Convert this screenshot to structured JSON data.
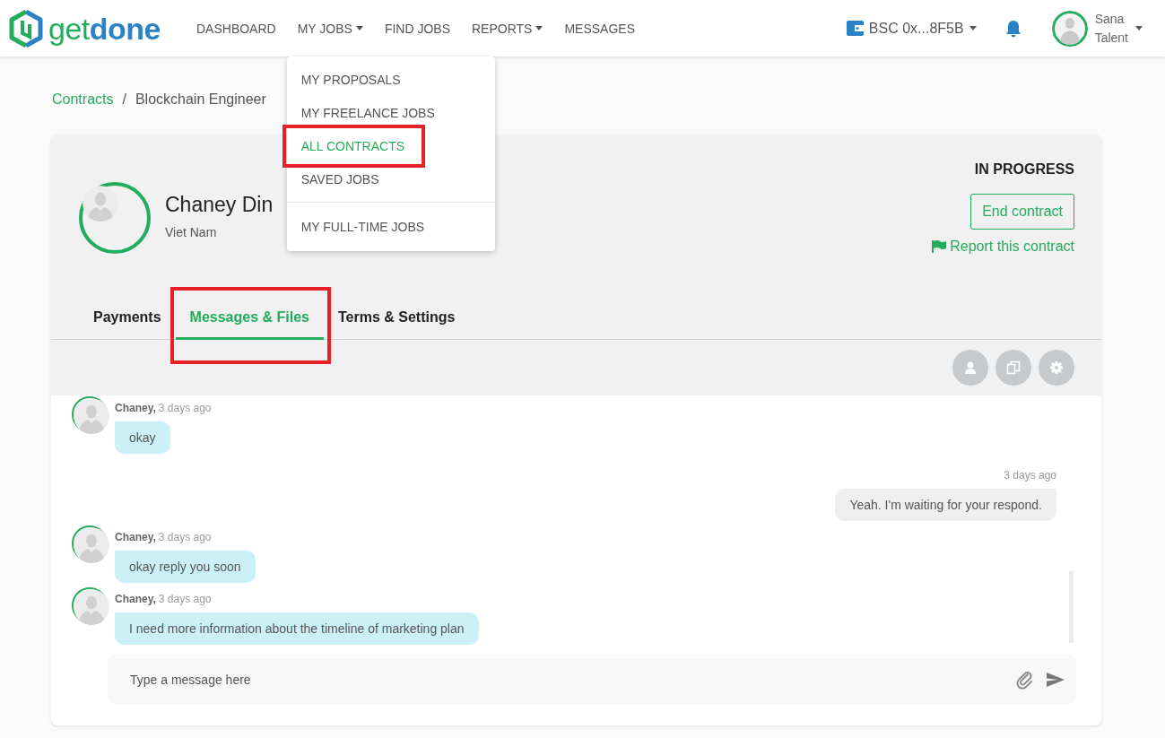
{
  "header": {
    "logo": {
      "part_1": "get",
      "part_2": "done"
    },
    "nav": [
      {
        "label": "DASHBOARD",
        "has_caret": false
      },
      {
        "label": "MY JOBS",
        "has_caret": true,
        "menu_sections": [
          {
            "items": [
              {
                "label": "MY PROPOSALS",
                "selected": false,
                "highlighted": false
              },
              {
                "label": "MY FREELANCE JOBS",
                "selected": false,
                "highlighted": false
              },
              {
                "label": "ALL CONTRACTS",
                "selected": true,
                "highlighted": true
              },
              {
                "label": "SAVED JOBS",
                "selected": false,
                "highlighted": false
              }
            ]
          },
          {
            "items": [
              {
                "label": "MY FULL-TIME JOBS",
                "selected": false,
                "highlighted": false
              }
            ]
          }
        ]
      },
      {
        "label": "FIND JOBS",
        "has_caret": false
      },
      {
        "label": "REPORTS",
        "has_caret": true
      },
      {
        "label": "MESSAGES",
        "has_caret": false
      }
    ],
    "wallet": {
      "label": "BSC 0x...8F5B"
    },
    "user": {
      "first_line": "Sana",
      "second_line": "Talent"
    }
  },
  "breadcrumb": {
    "items": [
      {
        "label": "Contracts",
        "link": true
      },
      {
        "label": "Blockchain Engineer",
        "link": false
      }
    ],
    "separator": "/"
  },
  "contract": {
    "name": "Chaney Din",
    "country": "Viet Nam",
    "status": "IN PROGRESS",
    "end_button": "End contract",
    "report_link": "Report this contract"
  },
  "tabs": [
    {
      "label": "Payments",
      "selected": false,
      "highlighted": false
    },
    {
      "label": "Messages & Files",
      "selected": true,
      "highlighted": true
    },
    {
      "label": "Terms & Settings",
      "selected": false,
      "highlighted": false
    }
  ],
  "messages": [
    {
      "kind": "incoming",
      "author": "Chaney,",
      "time": "3 days ago",
      "text": "okay"
    },
    {
      "kind": "outgoing",
      "time": "3 days ago",
      "text": "Yeah. I'm waiting for your respond."
    },
    {
      "kind": "incoming",
      "author": "Chaney,",
      "time": "3 days ago",
      "text": "okay reply you soon"
    },
    {
      "kind": "incoming",
      "author": "Chaney,",
      "time": "3 days ago",
      "text": "I need more information about the timeline of marketing plan"
    }
  ],
  "composer": {
    "placeholder": "Type a message here"
  }
}
